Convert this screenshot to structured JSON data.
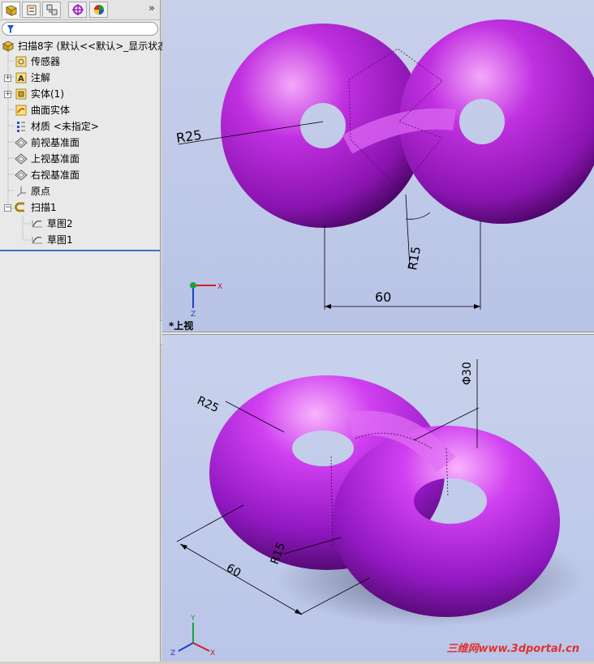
{
  "tabs": [
    "featuremanager-icon",
    "propertymanager-icon",
    "configurationmanager-icon",
    "dimxpert-icon",
    "display-manager-icon"
  ],
  "more": "»",
  "tree": {
    "root": "扫描8字  (默认<<默认>_显示状态",
    "items": [
      {
        "label": "传感器",
        "icon": "sensor-icon"
      },
      {
        "label": "注解",
        "icon": "annotation-icon"
      },
      {
        "label": "实体(1)",
        "icon": "solid-bodies-icon"
      },
      {
        "label": "曲面实体",
        "icon": "surface-bodies-icon"
      },
      {
        "label": "材质 <未指定>",
        "icon": "material-icon"
      },
      {
        "label": "前视基准面",
        "icon": "plane-icon"
      },
      {
        "label": "上视基准面",
        "icon": "plane-icon"
      },
      {
        "label": "右视基准面",
        "icon": "plane-icon"
      },
      {
        "label": "原点",
        "icon": "origin-icon"
      },
      {
        "label": "扫描1",
        "icon": "sweep-icon"
      },
      {
        "label": "草图2",
        "icon": "sketch-icon"
      },
      {
        "label": "草图1",
        "icon": "sketch-icon"
      }
    ]
  },
  "top_view": {
    "dim_r25": "R25",
    "dim_r15": "R15",
    "dim_60": "60",
    "label": "*上视",
    "axis_x": "X",
    "axis_z": "Z"
  },
  "iso_view": {
    "dim_r25": "R25",
    "dim_r15": "R15",
    "dim_60": "60",
    "dim_phi30": "Φ30",
    "axis_x": "X",
    "axis_y": "Y",
    "axis_z": "Z"
  },
  "watermark": "三维网www.3dportal.cn",
  "colors": {
    "body": "#b020d0",
    "highlight": "#f09af8",
    "shadow": "#5a0a78",
    "background": "#c3cceb"
  }
}
